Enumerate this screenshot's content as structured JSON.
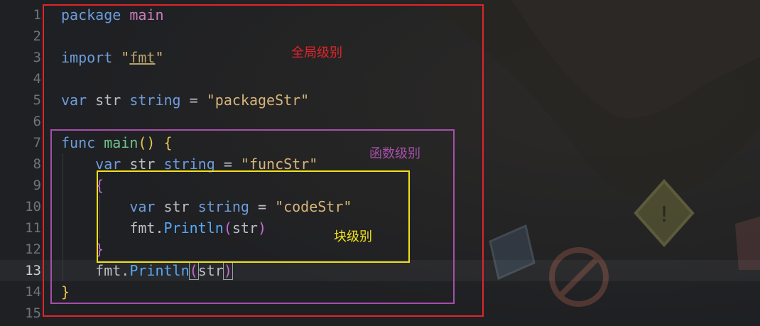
{
  "editor": {
    "line_numbers": [
      "1",
      "2",
      "3",
      "4",
      "5",
      "6",
      "7",
      "8",
      "9",
      "10",
      "11",
      "12",
      "13",
      "14",
      "15"
    ],
    "active_line": "13",
    "lines": {
      "l1": {
        "kw": "package",
        "name": "main"
      },
      "l3": {
        "kw": "import",
        "q1": "\"",
        "path": "fmt",
        "q2": "\""
      },
      "l5": {
        "kw": "var",
        "name": "str",
        "type": "string",
        "eq": "=",
        "value": "\"packageStr\""
      },
      "l7": {
        "kw": "func",
        "name": "main",
        "parens": "()",
        "brace": "{"
      },
      "l8": {
        "kw": "var",
        "name": "str",
        "type": "string",
        "eq": "=",
        "value": "\"funcStr\""
      },
      "l9": {
        "brace": "{"
      },
      "l10": {
        "kw": "var",
        "name": "str",
        "type": "string",
        "eq": "=",
        "value": "\"codeStr\""
      },
      "l11": {
        "pkg": "fmt",
        "dot": ".",
        "fn": "Println",
        "open": "(",
        "arg": "str",
        "close": ")"
      },
      "l12": {
        "brace": "}"
      },
      "l13": {
        "pkg": "fmt",
        "dot": ".",
        "fn": "Println",
        "open": "(",
        "arg": "str",
        "close": ")"
      },
      "l14": {
        "brace": "}"
      }
    }
  },
  "annotations": {
    "global_label": "全局级别",
    "func_label": "函数级别",
    "block_label": "块级别",
    "colors": {
      "global": "#e0242b",
      "func": "#a64fa8",
      "block": "#f2e11a"
    }
  }
}
